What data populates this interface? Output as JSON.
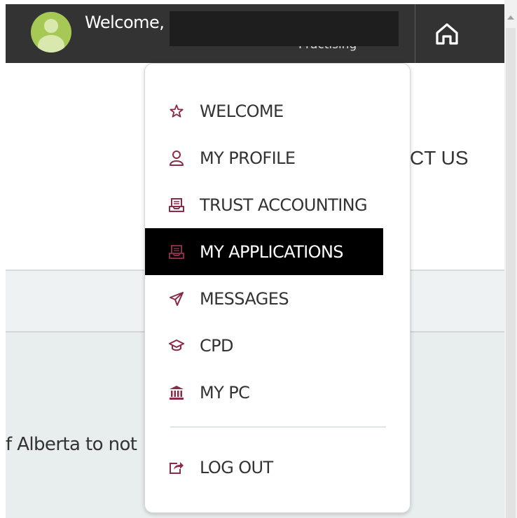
{
  "header": {
    "welcome_text": "Welcome,",
    "status_text": "Practising",
    "home_icon": "home-icon"
  },
  "page": {
    "contact_partial": "CT US",
    "body_partial": "f Alberta to not"
  },
  "menu": {
    "items": [
      {
        "label": "WELCOME",
        "icon": "star-icon"
      },
      {
        "label": "MY PROFILE",
        "icon": "user-icon"
      },
      {
        "label": "TRUST ACCOUNTING",
        "icon": "inbox-icon"
      },
      {
        "label": "MY APPLICATIONS",
        "icon": "inbox-icon",
        "active": true
      },
      {
        "label": "MESSAGES",
        "icon": "send-icon"
      },
      {
        "label": "CPD",
        "icon": "graduation-cap-icon"
      },
      {
        "label": "MY PC",
        "icon": "bank-icon"
      }
    ],
    "logout": {
      "label": "LOG OUT",
      "icon": "logout-icon"
    }
  },
  "colors": {
    "accent": "#8a2b47",
    "header_bg": "#333333",
    "active_bg": "#000000",
    "avatar": "#a6c955"
  }
}
